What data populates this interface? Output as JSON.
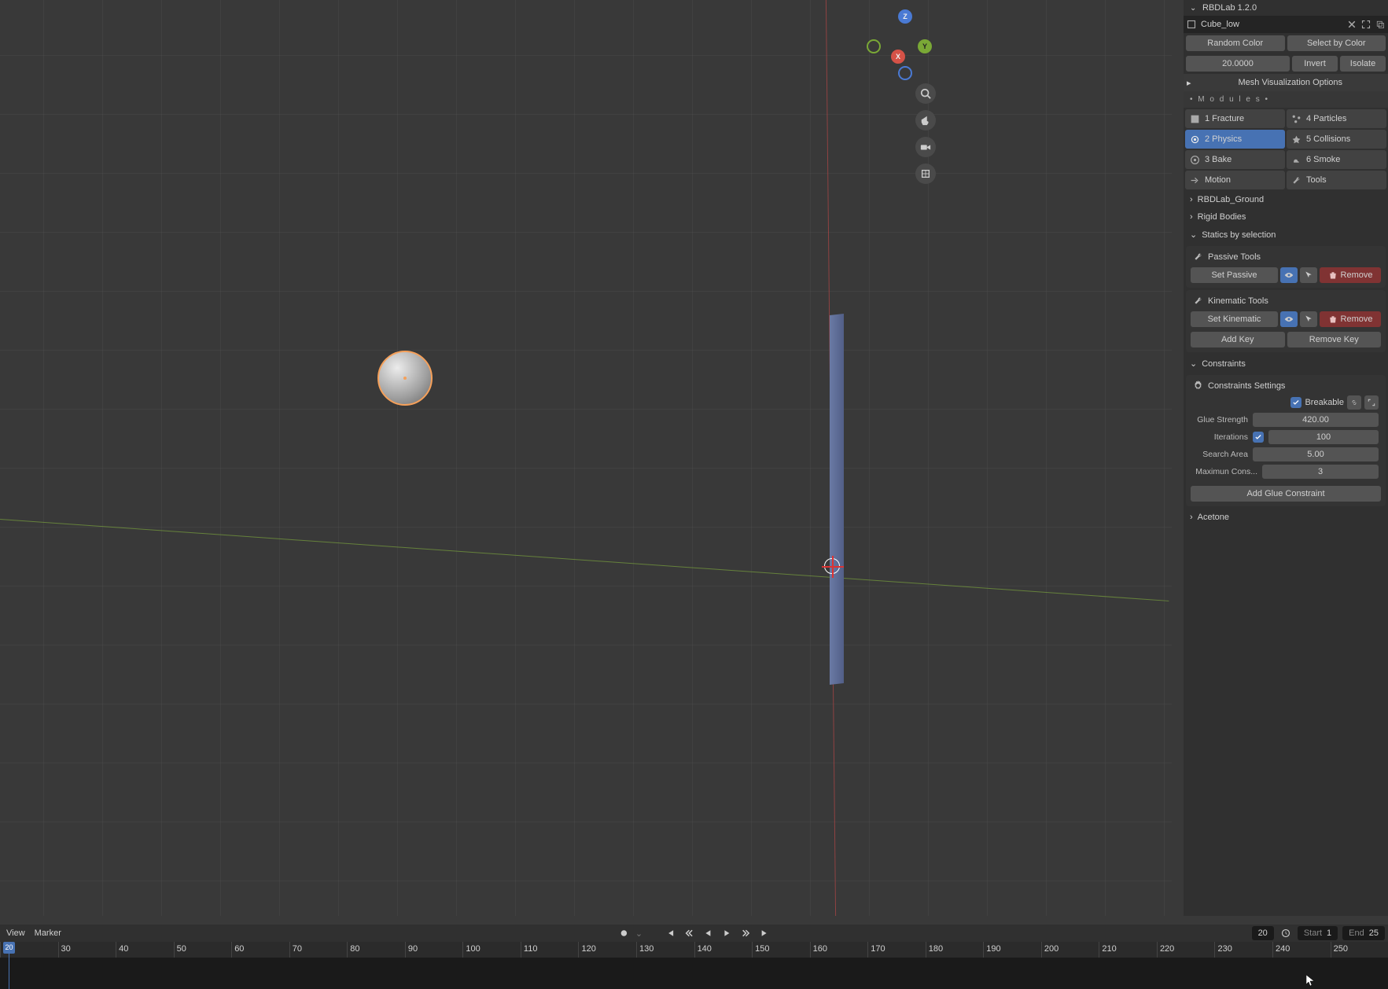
{
  "panel": {
    "title": "RBDLab 1.2.0",
    "object_name": "Cube_low",
    "random_color": "Random Color",
    "select_by_color": "Select by Color",
    "value": "20.0000",
    "invert": "Invert",
    "isolate": "Isolate",
    "mesh_vis": "Mesh Visualization Options",
    "modules_label": "• M o d u l e s •",
    "modules": [
      "1 Fracture",
      "4 Particles",
      "2 Physics",
      "5 Collisions",
      "3 Bake",
      "6 Smoke",
      "Motion",
      "Tools"
    ],
    "active_module": 2,
    "sections": {
      "ground": "RBDLab_Ground",
      "rigid": "Rigid Bodies",
      "statics": "Statics by selection",
      "passive_tools": "Passive Tools",
      "set_passive": "Set Passive",
      "remove1": "Remove",
      "kinematic_tools": "Kinematic Tools",
      "set_kinematic": "Set Kinematic",
      "remove2": "Remove",
      "add_key": "Add Key",
      "remove_key": "Remove Key",
      "constraints": "Constraints",
      "constraints_settings": "Constraints Settings",
      "breakable": "Breakable",
      "glue_strength_lbl": "Glue Strength",
      "glue_strength": "420.00",
      "iterations_lbl": "Iterations",
      "iterations": "100",
      "search_area_lbl": "Search Area",
      "search_area": "5.00",
      "max_cons_lbl": "Maximun Cons...",
      "max_cons": "3",
      "add_glue": "Add Glue Constraint",
      "acetone": "Acetone"
    }
  },
  "gizmo": {
    "z": "Z",
    "y": "Y",
    "x": "X"
  },
  "timeline": {
    "view": "View",
    "marker": "Marker",
    "current": "20",
    "start_lbl": "Start",
    "start": "1",
    "end_lbl": "End",
    "end": "25",
    "ticks": [
      "20",
      "30",
      "40",
      "50",
      "60",
      "70",
      "80",
      "90",
      "100",
      "110",
      "120",
      "130",
      "140",
      "150",
      "160",
      "170",
      "180",
      "190",
      "200",
      "210",
      "220",
      "230",
      "240",
      "250"
    ]
  }
}
